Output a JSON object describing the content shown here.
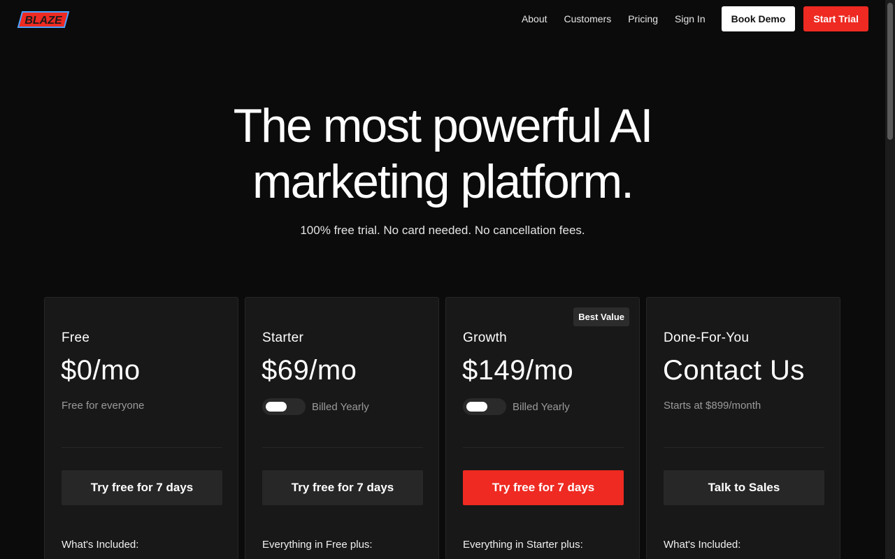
{
  "nav": {
    "logo_text": "BLAZE",
    "links": [
      "About",
      "Customers",
      "Pricing",
      "Sign In"
    ],
    "book_demo": "Book Demo",
    "start_trial": "Start Trial"
  },
  "hero": {
    "title_line1": "The most powerful AI",
    "title_line2": "marketing platform.",
    "subtitle": "100% free trial. No card needed. No cancellation fees."
  },
  "plans": [
    {
      "name": "Free",
      "price": "$0/mo",
      "note": "Free for everyone",
      "cta": "Try free for 7 days",
      "included": "What's Included:"
    },
    {
      "name": "Starter",
      "price": "$69/mo",
      "toggle_label": "Billed Yearly",
      "cta": "Try free for 7 days",
      "included": "Everything in Free plus:"
    },
    {
      "name": "Growth",
      "price": "$149/mo",
      "badge": "Best Value",
      "toggle_label": "Billed Yearly",
      "cta": "Try free for 7 days",
      "included": "Everything in Starter plus:"
    },
    {
      "name": "Done-For-You",
      "price": "Contact Us",
      "note": "Starts at $899/month",
      "cta": "Talk to Sales",
      "included": "What's Included:"
    }
  ],
  "colors": {
    "accent": "#ee2a22",
    "background": "#0b0b0b",
    "card": "#181818"
  }
}
